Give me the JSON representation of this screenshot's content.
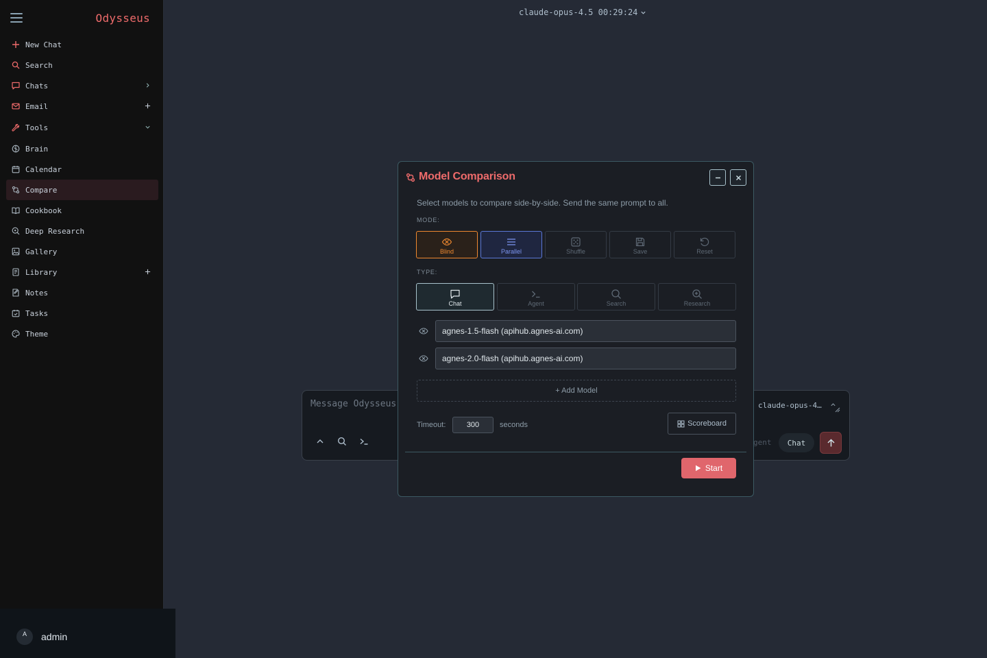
{
  "app": {
    "brand": "Odysseus"
  },
  "top_model": {
    "label": "claude-opus-4.5 00:29:24"
  },
  "sidebar": {
    "items": [
      {
        "label": "New Chat",
        "icon": "plus-icon"
      },
      {
        "label": "Search",
        "icon": "search-icon"
      },
      {
        "label": "Chats",
        "icon": "chat-icon",
        "trail": "chevron-right-icon"
      },
      {
        "label": "Email",
        "icon": "mail-icon",
        "trail": "plus-icon"
      },
      {
        "label": "Tools",
        "icon": "wrench-icon",
        "trail": "chevron-down-icon"
      },
      {
        "label": "Brain",
        "icon": "brain-icon"
      },
      {
        "label": "Calendar",
        "icon": "calendar-icon"
      },
      {
        "label": "Compare",
        "icon": "compare-icon",
        "active": true
      },
      {
        "label": "Cookbook",
        "icon": "book-icon"
      },
      {
        "label": "Deep Research",
        "icon": "research-icon"
      },
      {
        "label": "Gallery",
        "icon": "image-icon"
      },
      {
        "label": "Library",
        "icon": "library-icon",
        "trail": "plus-icon"
      },
      {
        "label": "Notes",
        "icon": "notes-icon"
      },
      {
        "label": "Tasks",
        "icon": "tasks-icon"
      },
      {
        "label": "Theme",
        "icon": "palette-icon"
      }
    ]
  },
  "user": {
    "initial": "A",
    "name": "admin"
  },
  "composer": {
    "placeholder": "Message Odysseus",
    "model": "claude-opus-4…",
    "mode_agent": "gent",
    "mode_chat": "Chat"
  },
  "modal": {
    "title": "Model Comparison",
    "description": "Select models to compare side-by-side. Send the same prompt to all.",
    "mode_label": "MODE:",
    "modes": [
      "Blind",
      "Parallel",
      "Shuffle",
      "Save",
      "Reset"
    ],
    "type_label": "TYPE:",
    "types": [
      "Chat",
      "Agent",
      "Search",
      "Research"
    ],
    "models": [
      "agnes-1.5-flash (apihub.agnes-ai.com)",
      "agnes-2.0-flash (apihub.agnes-ai.com)"
    ],
    "add_model": "+ Add Model",
    "timeout_label": "Timeout:",
    "timeout_value": "300",
    "seconds_label": "seconds",
    "scoreboard": "Scoreboard",
    "start": "Start"
  },
  "colors": {
    "accent": "#ee6b6b",
    "blind": "#f0892f",
    "parallel": "#5b78d8",
    "selected_type": "#a9c3cc",
    "background": "#252a35",
    "sidebar": "#111111"
  }
}
